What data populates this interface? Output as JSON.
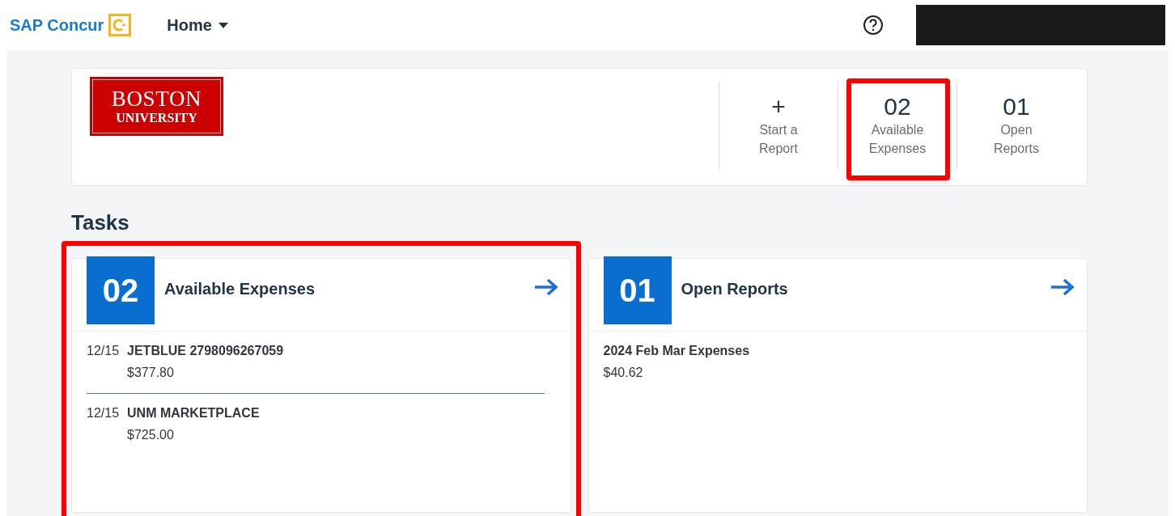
{
  "header": {
    "brand": "SAP Concur",
    "nav": {
      "label": "Home"
    },
    "redacted": true
  },
  "company_logo": {
    "line_1": "BOSTON",
    "line_2": "UNIVERSITY"
  },
  "quick_actions": [
    {
      "kind": "action",
      "symbol": "+",
      "label": "Start a Report",
      "highlighted": false
    },
    {
      "kind": "count",
      "symbol": "02",
      "label": "Available Expenses",
      "highlighted": true
    },
    {
      "kind": "count",
      "symbol": "01",
      "label": "Open Reports",
      "highlighted": false
    }
  ],
  "tasks": {
    "title": "Tasks",
    "cards": [
      {
        "count": "02",
        "title": "Available Expenses",
        "highlighted": true,
        "items": [
          {
            "date": "12/15",
            "name": "JETBLUE 2798096267059",
            "amount": "$377.80"
          },
          {
            "date": "12/15",
            "name": "UNM MARKETPLACE",
            "amount": "$725.00"
          }
        ]
      },
      {
        "count": "01",
        "title": "Open Reports",
        "highlighted": false,
        "items": [
          {
            "name": "2024 Feb Mar Expenses",
            "amount": "$40.62"
          }
        ]
      }
    ]
  }
}
